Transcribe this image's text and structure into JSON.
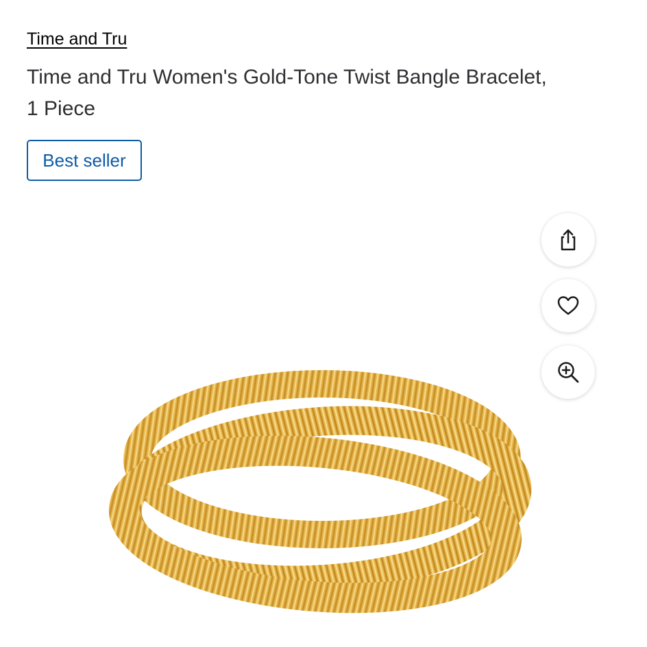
{
  "product": {
    "brand": "Time and Tru",
    "title_line1": "Time and Tru Women's Gold-Tone Twist Bangle Bracelet,",
    "title_line2": "1 Piece",
    "badge": "Best seller"
  },
  "actions": {
    "share_icon": "share-icon",
    "favorite_icon": "heart-icon",
    "zoom_icon": "zoom-in-icon"
  },
  "colors": {
    "accent": "#0e5ba6",
    "text": "#2e2f32",
    "gold": "#e4b547"
  }
}
